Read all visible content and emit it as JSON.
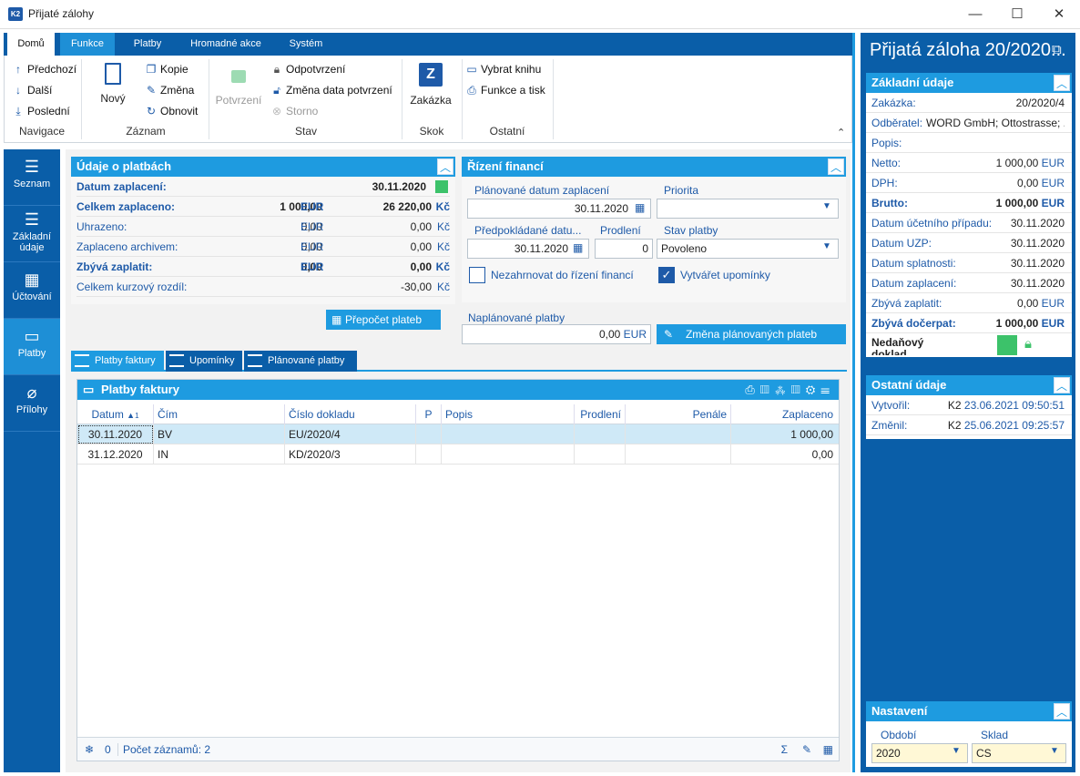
{
  "window": {
    "title": "Přijaté zálohy",
    "app_icon": "K2"
  },
  "ribbon": {
    "tabs": [
      "Domů",
      "Funkce",
      "Platby",
      "Hromadné akce",
      "Systém"
    ],
    "navigace": {
      "prev": "Předchozí",
      "next": "Další",
      "last": "Poslední",
      "label": "Navigace"
    },
    "zaznam": {
      "new": "Nový",
      "copy": "Kopie",
      "change": "Změna",
      "refresh": "Obnovit",
      "label": "Záznam"
    },
    "stav": {
      "confirm": "Potvrzení",
      "unconfirm": "Odpotvrzení",
      "change_date": "Změna data potvrzení",
      "storno": "Storno",
      "label": "Stav"
    },
    "skok": {
      "zakazka": "Zakázka",
      "label": "Skok"
    },
    "ostatni": {
      "book": "Vybrat knihu",
      "print": "Funkce a tisk",
      "label": "Ostatní"
    }
  },
  "left_nav": [
    {
      "label": "Seznam"
    },
    {
      "label": "Základní údaje"
    },
    {
      "label": "Účtování"
    },
    {
      "label": "Platby"
    },
    {
      "label": "Přílohy"
    }
  ],
  "payments": {
    "title": "Údaje o platbách",
    "rows": [
      {
        "label": "Datum zaplacení:",
        "v1": "",
        "c1": "",
        "v2": "30.11.2020",
        "c2": ""
      },
      {
        "label": "Celkem zaplaceno:",
        "v1": "1 000,00",
        "c1": "EUR",
        "v2": "26 220,00",
        "c2": "Kč"
      },
      {
        "label": "Uhrazeno:",
        "v1": "0,00",
        "c1": "EUR",
        "v2": "0,00",
        "c2": "Kč"
      },
      {
        "label": "Zaplaceno archivem:",
        "v1": "0,00",
        "c1": "EUR",
        "v2": "0,00",
        "c2": "Kč"
      },
      {
        "label": "Zbývá zaplatit:",
        "v1": "0,00",
        "c1": "EUR",
        "v2": "0,00",
        "c2": "Kč"
      },
      {
        "label": "Celkem kurzový rozdíl:",
        "v1": "",
        "c1": "",
        "v2": "-30,00",
        "c2": "Kč"
      }
    ],
    "recalc_button": "Přepočet plateb"
  },
  "finance": {
    "title": "Řízení financí",
    "planned_date_label": "Plánované datum zaplacení",
    "planned_date": "30.11.2020",
    "priority_label": "Priorita",
    "priority": "",
    "expected_date_label": "Předpokládané datu...",
    "expected_date": "30.11.2020",
    "delay_label": "Prodlení",
    "delay": "0",
    "state_label": "Stav platby",
    "state": "Povoleno",
    "exclude_label": "Nezahrnovat do řízení financí",
    "reminders_label": "Vytvářet upomínky",
    "planned_label": "Naplánované platby",
    "planned_value": "0,00",
    "planned_currency": "EUR",
    "planned_button": "Změna plánovaných plateb"
  },
  "grid_tabs": [
    "Platby faktury",
    "Upomínky",
    "Plánované platby"
  ],
  "grid": {
    "title": "Platby faktury",
    "columns": [
      "Datum",
      "Čím",
      "Číslo dokladu",
      "P",
      "Popis",
      "Prodlení",
      "Penále",
      "Zaplaceno"
    ],
    "sort_marker": "1",
    "rows": [
      [
        "30.11.2020",
        "BV",
        "EU/2020/4",
        "",
        "",
        "",
        "",
        "1 000,00"
      ],
      [
        "31.12.2020",
        "IN",
        "KD/2020/3",
        "",
        "",
        "",
        "",
        "0,00"
      ]
    ],
    "footer_count": "0",
    "footer_records": "Počet záznamů: 2"
  },
  "right": {
    "title": "Přijatá záloha 20/2020...",
    "basic_title": "Základní údaje",
    "basic_rows": [
      {
        "label": "Zakázka:",
        "value": "20/2020/4"
      },
      {
        "label": "Odběratel:",
        "value": "WORD GmbH; Ottostrasse; ..."
      },
      {
        "label": "Popis:",
        "value": ""
      },
      {
        "label": "Netto:",
        "value": "1 000,00",
        "cur": "EUR"
      },
      {
        "label": "DPH:",
        "value": "0,00",
        "cur": "EUR"
      },
      {
        "label": "Brutto:",
        "value": "1 000,00",
        "cur": "EUR"
      },
      {
        "label": "Datum účetního případu:",
        "value": "30.11.2020"
      },
      {
        "label": "Datum UZP:",
        "value": "30.11.2020"
      },
      {
        "label": "Datum splatnosti:",
        "value": "30.11.2020"
      },
      {
        "label": "Datum zaplacení:",
        "value": "30.11.2020"
      },
      {
        "label": "Zbývá zaplatit:",
        "value": "0,00",
        "cur": "EUR"
      },
      {
        "label": "Zbývá dočerpat:",
        "value": "1 000,00",
        "cur": "EUR"
      }
    ],
    "untaxed_label": "Nedaňový doklad",
    "other_title": "Ostatní údaje",
    "created_label": "Vytvořil:",
    "created_user": "K2",
    "created_at": "23.06.2021 09:50:51",
    "changed_label": "Změnil:",
    "changed_user": "K2",
    "changed_at": "25.06.2021 09:25:57",
    "settings_title": "Nastavení",
    "period_label": "Období",
    "period": "2020",
    "store_label": "Sklad",
    "store": "CS"
  },
  "colors": {
    "accent": "#1e9be0",
    "nav": "#0a5ea8",
    "green": "#3cc26a"
  }
}
